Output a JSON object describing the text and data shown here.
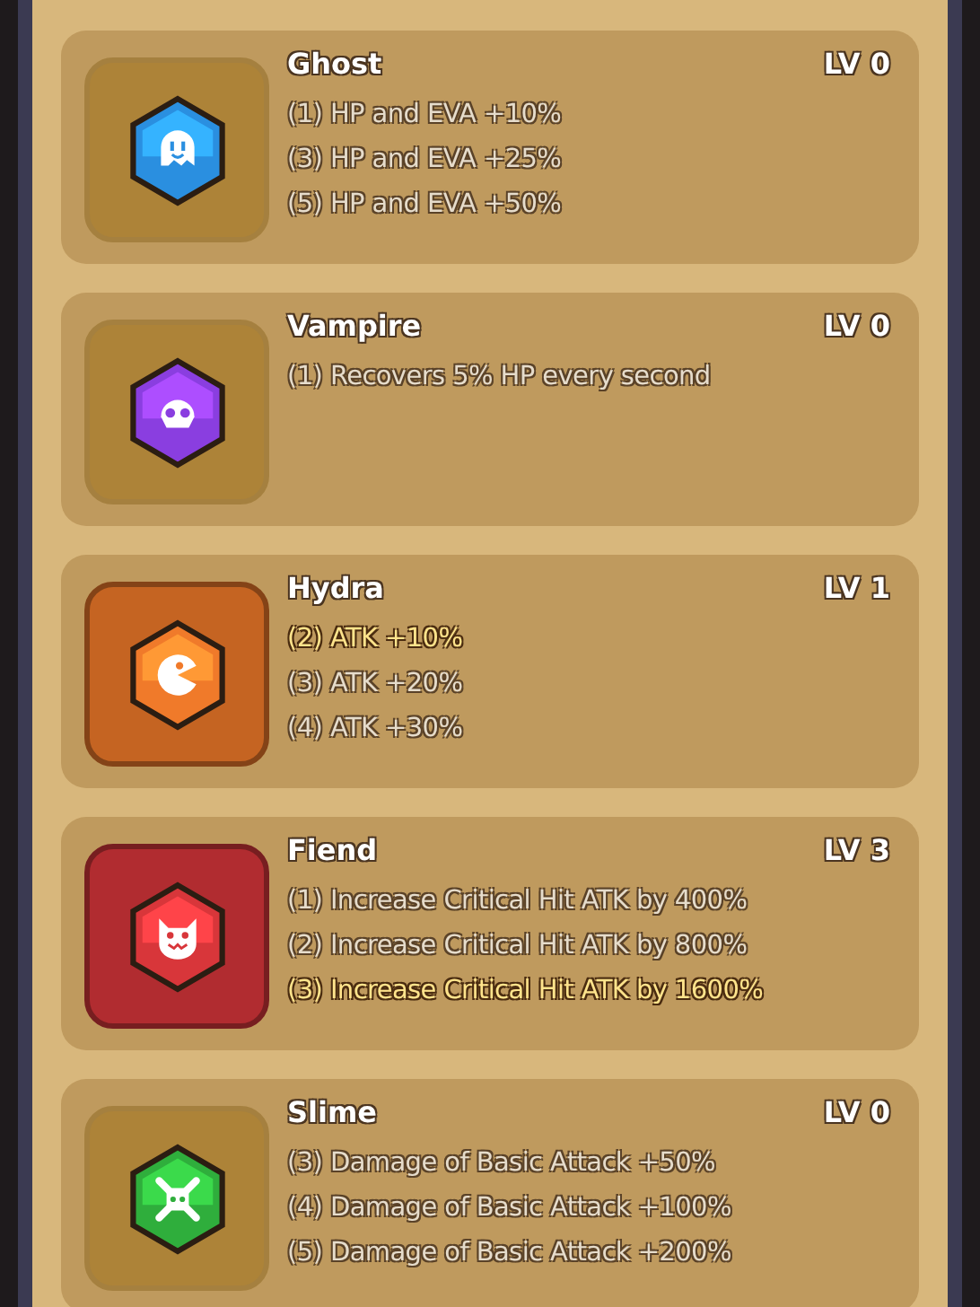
{
  "skills": [
    {
      "name": "Ghost",
      "level": "LV 0",
      "active": false,
      "color": "#2a8fe0",
      "effects": [
        {
          "text": "(1) HP and EVA +10%",
          "active": false
        },
        {
          "text": "(3) HP and EVA +25%",
          "active": false
        },
        {
          "text": "(5) HP and EVA +50%",
          "active": false
        }
      ]
    },
    {
      "name": "Vampire",
      "level": "LV 0",
      "active": false,
      "color": "#8a3ee0",
      "effects": [
        {
          "text": "(1) Recovers 5% HP every second",
          "active": false
        }
      ]
    },
    {
      "name": "Hydra",
      "level": "LV 1",
      "active": true,
      "color": "#f07a2a",
      "effects": [
        {
          "text": "(2) ATK +10%",
          "active": true
        },
        {
          "text": "(3) ATK +20%",
          "active": false
        },
        {
          "text": "(4) ATK +30%",
          "active": false
        }
      ]
    },
    {
      "name": "Fiend",
      "level": "LV 3",
      "active": true,
      "color": "#d8363a",
      "effects": [
        {
          "text": "(1) Increase Critical Hit ATK by 400%",
          "active": false
        },
        {
          "text": "(2) Increase Critical Hit ATK by 800%",
          "active": false
        },
        {
          "text": "(3) Increase Critical Hit ATK by 1600%",
          "active": true
        }
      ]
    },
    {
      "name": "Slime",
      "level": "LV 0",
      "active": false,
      "color": "#2fae3c",
      "effects": [
        {
          "text": "(3) Damage of Basic Attack +50%",
          "active": false
        },
        {
          "text": "(4) Damage of Basic Attack +100%",
          "active": false
        },
        {
          "text": "(5) Damage of Basic Attack +200%",
          "active": false
        }
      ]
    }
  ]
}
